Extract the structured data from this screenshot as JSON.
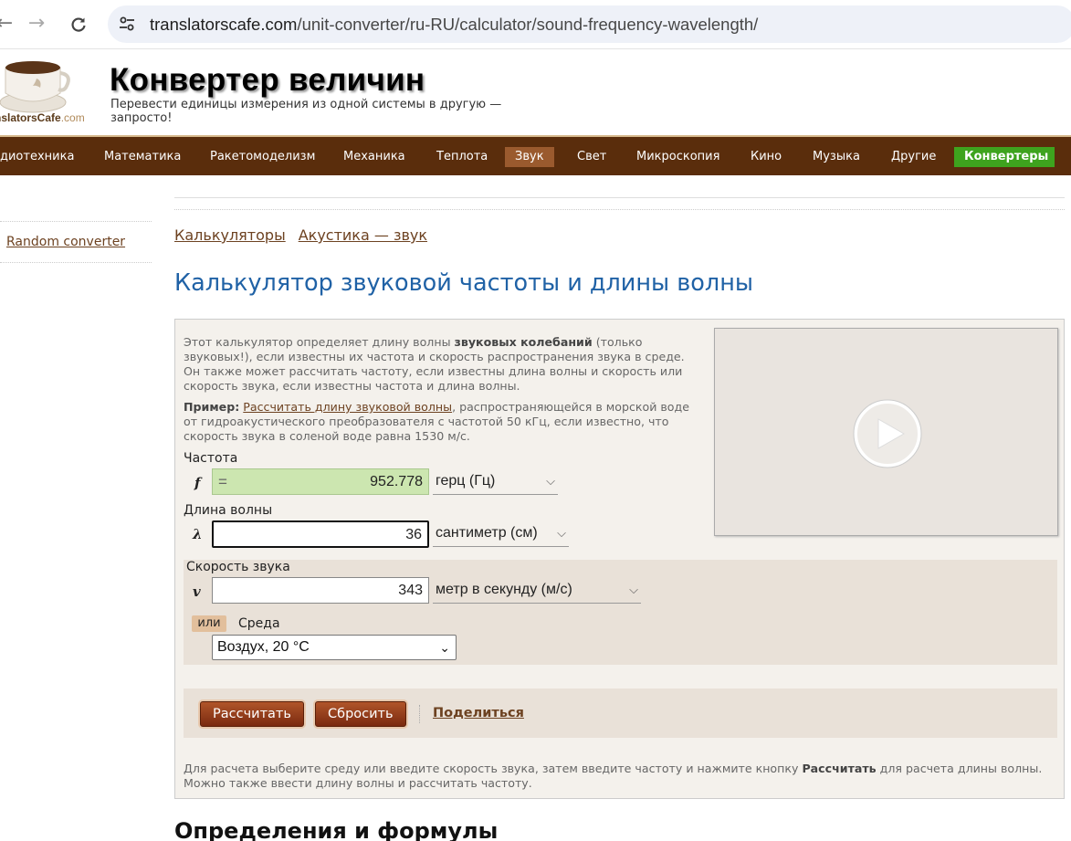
{
  "browser": {
    "url_domain": "translatorscafe.com",
    "url_path": "/unit-converter/ru-RU/calculator/sound-frequency-wavelength/",
    "back_icon": "arrow-left-icon",
    "forward_icon": "arrow-right-icon",
    "reload_icon": "reload-icon"
  },
  "header": {
    "logo_name": "nslatorsCafe",
    "logo_domain": ".com",
    "title": "Конвертер величин",
    "subtitle": "Перевести единицы измерения из одной системы в другую — запросто!"
  },
  "menu": {
    "items": [
      "диотехника",
      "Математика",
      "Ракетомоделизм",
      "Механика",
      "Теплота",
      "Звук",
      "Свет",
      "Микроскопия",
      "Кино",
      "Музыка",
      "Другие",
      "Конвертеры"
    ],
    "active": "Звук"
  },
  "sidebar": {
    "random_converter": "Random converter"
  },
  "breadcrumbs": [
    "Калькуляторы",
    "Акустика — звук"
  ],
  "page_title": "Калькулятор звуковой частоты и длины волны",
  "calculator": {
    "desc_1": "Этот калькулятор определяет длину волны ",
    "desc_bold": "звуковых колебаний",
    "desc_2": " (только звуковых!), если известны их частота и скорость распространения звука в среде. Он также может рассчитать частоту, если известны длина волны и скорость или скорость звука, если известны частота и длина волны.",
    "example_label": "Пример:",
    "example_link": "Рассчитать длину звуковой волны",
    "example_text": ", распространяющейся в морской воде от гидроакустического преобразователя с частотой 50 кГц, если известно, что скорость звука в соленой воде равна 1530 м/с.",
    "frequency": {
      "label": "Частота",
      "var": "f",
      "eq": "=",
      "value": "952.778",
      "unit": "герц (Гц)"
    },
    "wavelength": {
      "label": "Длина волны",
      "var": "λ",
      "value": "36",
      "unit": "сантиметр (см)"
    },
    "speed": {
      "label": "Скорость звука",
      "var": "v",
      "value": "343",
      "unit": "метр в секунду (м/с)"
    },
    "or_label": "или",
    "medium_label": "Среда",
    "medium_value": "Воздух, 20 °C",
    "calculate": "Рассчитать",
    "reset": "Сбросить",
    "share": "Поделиться",
    "foot_1": "Для расчета выберите среду или введите скорость звука, затем введите частоту и нажмите кнопку ",
    "foot_bold": "Рассчитать",
    "foot_2": " для расчета длины волны. Можно также ввести длину волны и рассчитать частоту."
  },
  "section_heading": "Определения и формулы",
  "colors": {
    "menu_bg": "#5a2d0c",
    "active_menu": "#9a5a2e",
    "green": "#3ea31e",
    "title_blue": "#2062a6",
    "result_green": "#cce6b0"
  }
}
